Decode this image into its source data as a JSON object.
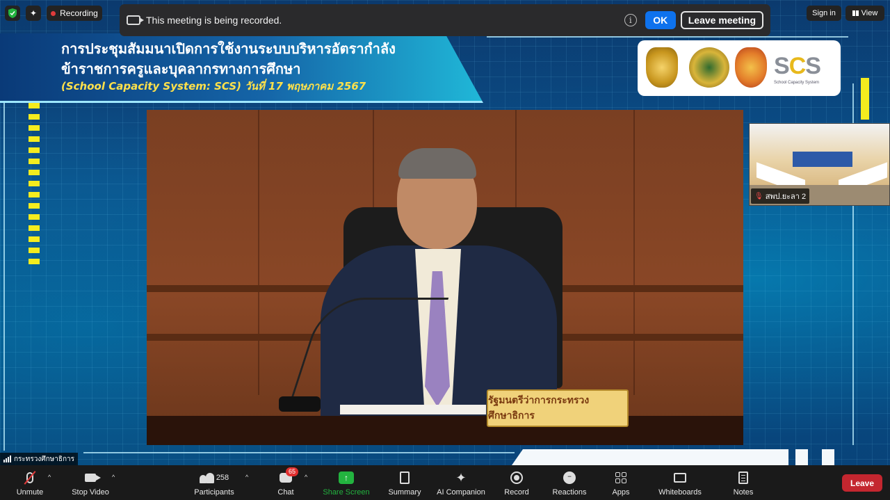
{
  "top": {
    "recording_label": "Recording",
    "notice_message": "This meeting is being recorded.",
    "ok_label": "OK",
    "leave_meeting_label": "Leave meeting",
    "sign_in_label": "Sign in",
    "view_label": "View"
  },
  "shared_screen": {
    "title_line1": "การประชุมสัมมนาเปิดการใช้งานระบบบริหารอัตรากำลัง",
    "title_line2": "ข้าราชการครูและบุคลากรทางการศึกษา",
    "title_line3": "(School Capacity System: SCS) วันที่ 17 พฤษภาคม 2567",
    "logo_text": "SCS",
    "logo_subtext": "School Capacity System",
    "nameplate": "รัฐมนตรีว่าการกระทรวงศึกษาธิการ"
  },
  "videos": {
    "thumbnail_name": "สพป.ยะลา 2",
    "active_speaker": "กระทรวงศึกษาธิการ"
  },
  "toolbar": {
    "unmute": "Unmute",
    "stop_video": "Stop Video",
    "participants": "Participants",
    "participant_count": "258",
    "chat": "Chat",
    "chat_badge": "65",
    "share_screen": "Share Screen",
    "summary": "Summary",
    "ai_companion": "AI Companion",
    "record": "Record",
    "reactions": "Reactions",
    "apps": "Apps",
    "whiteboards": "Whiteboards",
    "notes": "Notes",
    "leave": "Leave"
  },
  "colors": {
    "accent_blue": "#0e72ed",
    "share_green": "#23b33f",
    "leave_red": "#c4262f",
    "recording_red": "#e03b3b",
    "title_yellow": "#ffe14a"
  }
}
